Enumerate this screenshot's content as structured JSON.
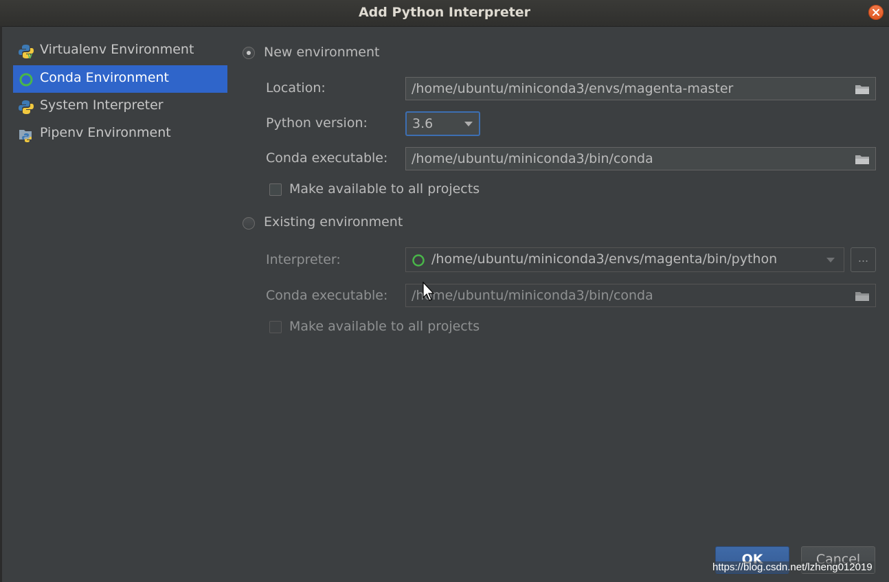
{
  "window": {
    "title": "Add Python Interpreter"
  },
  "sidebar": {
    "items": [
      {
        "label": "Virtualenv Environment",
        "icon": "python-virtualenv-icon",
        "selected": false
      },
      {
        "label": "Conda Environment",
        "icon": "conda-ring-icon",
        "selected": true
      },
      {
        "label": "System Interpreter",
        "icon": "python-icon",
        "selected": false
      },
      {
        "label": "Pipenv Environment",
        "icon": "pipenv-icon",
        "selected": false
      }
    ]
  },
  "new_env": {
    "radio_label": "New environment",
    "selected": true,
    "location_label": "Location:",
    "location_value": "/home/ubuntu/miniconda3/envs/magenta-master",
    "python_version_label": "Python version:",
    "python_version_value": "3.6",
    "conda_exe_label": "Conda executable:",
    "conda_exe_value": "/home/ubuntu/miniconda3/bin/conda",
    "make_available_label": "Make available to all projects",
    "make_available_checked": false
  },
  "existing_env": {
    "radio_label": "Existing environment",
    "selected": false,
    "interpreter_label": "Interpreter:",
    "interpreter_value": "/home/ubuntu/miniconda3/envs/magenta/bin/python",
    "browse_label": "...",
    "conda_exe_label": "Conda executable:",
    "conda_exe_value": "/home/ubuntu/miniconda3/bin/conda",
    "make_available_label": "Make available to all projects",
    "make_available_checked": false
  },
  "buttons": {
    "ok": "OK",
    "cancel": "Cancel"
  },
  "watermark": "https://blog.csdn.net/lzheng012019",
  "colors": {
    "background": "#3c3f41",
    "selection": "#2f65ca",
    "focus": "#3d6fb3",
    "close": "#e95420"
  }
}
